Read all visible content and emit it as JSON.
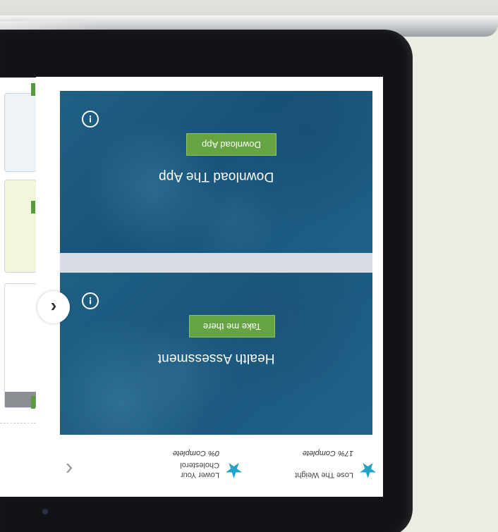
{
  "cards": [
    {
      "title": "Health Assessment",
      "cta_label": "Take me there",
      "info_icon": "info-icon"
    },
    {
      "title": "Download The App",
      "cta_label": "Download App",
      "info_icon": "info-icon"
    }
  ],
  "carousel": {
    "prev_glyph": "‹"
  },
  "goals": [
    {
      "name_line1": "Lose The Weight",
      "name_line2": "",
      "progress_label": "17% Complete",
      "progress_value": 0.17,
      "star_icon": "star-icon"
    },
    {
      "name_line1": "Lower Your",
      "name_line2": "Cholesterol",
      "progress_label": "0% Complete",
      "progress_value": 0.0,
      "star_icon": "star-icon"
    }
  ],
  "goals_nav": {
    "next_glyph": "‹"
  },
  "colors": {
    "accent_green": "#66a343",
    "star_blue": "#24a3c9",
    "card_overlay": "#1f5878",
    "tablet_frame": "#121316"
  }
}
